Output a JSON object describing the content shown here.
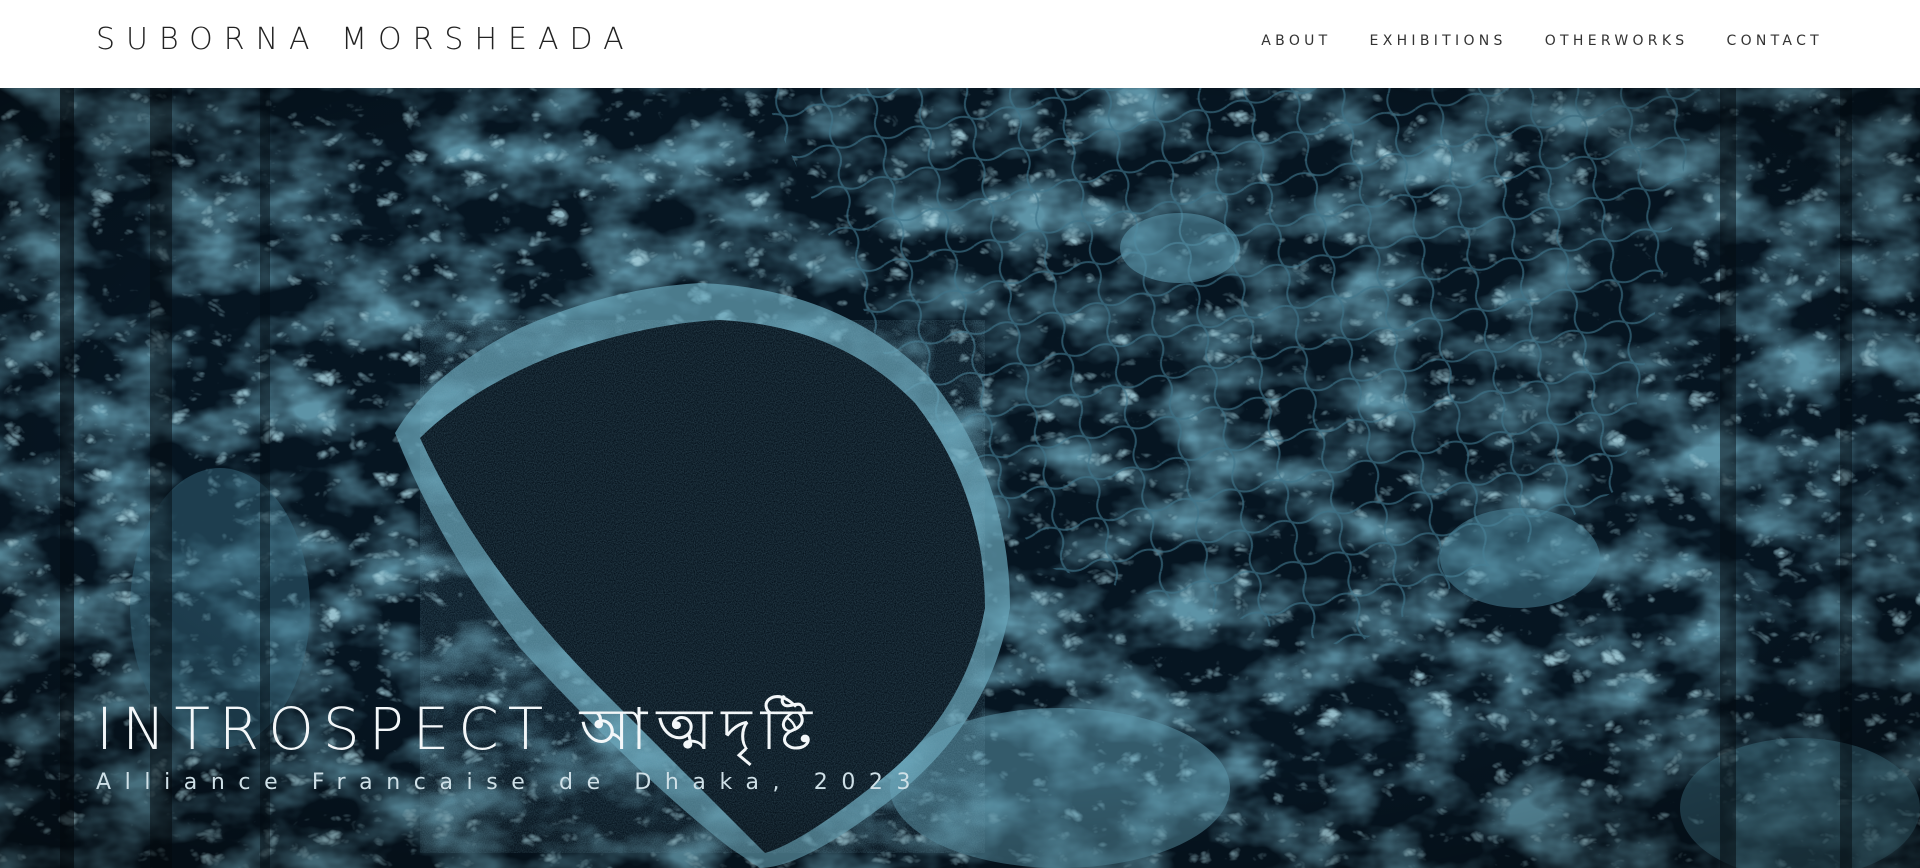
{
  "header": {
    "site_title": "SUBORNA MORSHEADA",
    "nav": [
      {
        "label": "ABOUT"
      },
      {
        "label": "EXHIBITIONS"
      },
      {
        "label": "OTHERWORKS"
      },
      {
        "label": "CONTACT"
      }
    ]
  },
  "hero": {
    "title": "INTROSPECT আত্মদৃষ্টি",
    "subtitle": "Alliance Francaise de Dhaka, 2023",
    "image_palette": {
      "dark": "#04101a",
      "mid": "#1d4a61",
      "light": "#5c98ad"
    }
  }
}
